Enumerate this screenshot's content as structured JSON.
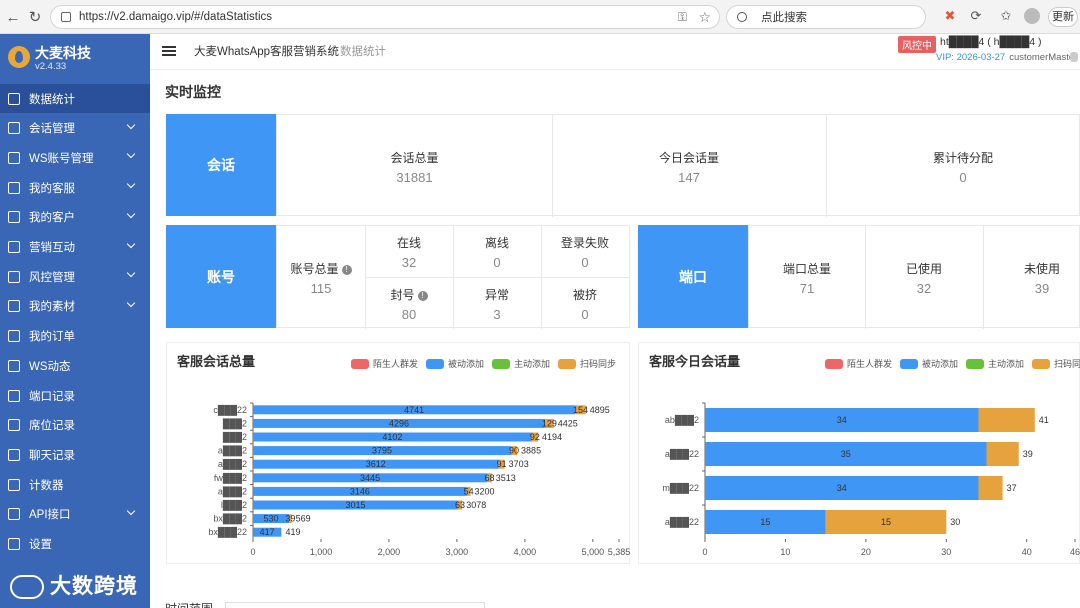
{
  "browser": {
    "url": "https://v2.damaigo.vip/#/dataStatistics",
    "search_placeholder": "点此搜索",
    "update_label": "更新"
  },
  "sidebar": {
    "brand": "大麦科技",
    "version": "v2.4.33",
    "items": [
      {
        "label": "数据统计",
        "icon": "bar-chart-icon",
        "expandable": false
      },
      {
        "label": "会话管理",
        "icon": "gear-icon",
        "expandable": true
      },
      {
        "label": "WS账号管理",
        "icon": "whatsapp-icon",
        "expandable": true
      },
      {
        "label": "我的客服",
        "icon": "headset-icon",
        "expandable": true
      },
      {
        "label": "我的客户",
        "icon": "user-icon",
        "expandable": true
      },
      {
        "label": "营销互动",
        "icon": "megaphone-icon",
        "expandable": true
      },
      {
        "label": "风控管理",
        "icon": "bell-icon",
        "expandable": true
      },
      {
        "label": "我的素材",
        "icon": "image-icon",
        "expandable": true
      },
      {
        "label": "我的订单",
        "icon": "order-icon",
        "expandable": false
      },
      {
        "label": "WS动态",
        "icon": "globe-icon",
        "expandable": false
      },
      {
        "label": "端口记录",
        "icon": "port-icon",
        "expandable": false
      },
      {
        "label": "席位记录",
        "icon": "seat-icon",
        "expandable": false
      },
      {
        "label": "聊天记录",
        "icon": "chat-icon",
        "expandable": false
      },
      {
        "label": "计数器",
        "icon": "calculator-icon",
        "expandable": false
      },
      {
        "label": "API接口",
        "icon": "api-icon",
        "expandable": true
      },
      {
        "label": "设置",
        "icon": "settings-icon",
        "expandable": false
      }
    ],
    "watermark": "大数跨境"
  },
  "header": {
    "breadcrumb_root": "大麦WhatsApp客服营销系统",
    "breadcrumb_current": "数据统计",
    "risk_badge": "风控中",
    "account": "ht████4 ( h████4 )",
    "vip": "VIP: 2026-03-27",
    "user": "customerMaster"
  },
  "main": {
    "section_title": "实时监控",
    "session": {
      "tile": "会话",
      "total_label": "会话总量",
      "total_value": "31881",
      "today_label": "今日会话量",
      "today_value": "147",
      "pending_label": "累计待分配",
      "pending_value": "0"
    },
    "account": {
      "tile": "账号",
      "total_label": "账号总量",
      "total_value": "115",
      "online_label": "在线",
      "online_value": "32",
      "offline_label": "离线",
      "offline_value": "0",
      "loginfail_label": "登录失败",
      "loginfail_value": "0",
      "banned_label": "封号",
      "banned_value": "80",
      "abnormal_label": "异常",
      "abnormal_value": "3",
      "kicked_label": "被挤",
      "kicked_value": "0"
    },
    "port": {
      "tile": "端口",
      "total_label": "端口总量",
      "total_value": "71",
      "used_label": "已使用",
      "used_value": "32",
      "unused_label": "未使用",
      "unused_value": "39"
    },
    "bottom_label": "时间范围"
  },
  "legend": [
    {
      "name": "陌生人群发",
      "color": "#ee6666"
    },
    {
      "name": "被动添加",
      "color": "#3f96f4"
    },
    {
      "name": "主动添加",
      "color": "#67c23a"
    },
    {
      "name": "扫码同步",
      "color": "#e6a23c"
    }
  ],
  "chart_data": [
    {
      "type": "bar",
      "orientation": "horizontal",
      "stacked": true,
      "title": "客服会话总量",
      "categories": [
        "c███22",
        "███2",
        "███2",
        "a███2",
        "a███2",
        "fw███2",
        "a███2",
        "l███2",
        "bx███2",
        "bx███22"
      ],
      "series": [
        {
          "name": "陌生人群发",
          "values": [
            0,
            0,
            0,
            0,
            0,
            0,
            0,
            0,
            0,
            0
          ]
        },
        {
          "name": "被动添加",
          "values": [
            4741,
            4296,
            4102,
            3795,
            3612,
            3445,
            3146,
            3015,
            530,
            417
          ]
        },
        {
          "name": "主动添加",
          "values": [
            0,
            0,
            0,
            0,
            0,
            0,
            0,
            0,
            0,
            0
          ]
        },
        {
          "name": "扫码同步",
          "values": [
            154,
            129,
            92,
            90,
            91,
            68,
            54,
            63,
            39,
            2
          ]
        }
      ],
      "series_labels": {
        "被动添加": [
          "4741",
          "4296",
          "4102",
          "3795",
          "3612",
          "3445",
          "3146",
          "3015",
          "530",
          "417"
        ],
        "扫码同步": [
          "154",
          "129",
          "92",
          "90",
          "91",
          "68",
          "54",
          "63",
          "39",
          ""
        ]
      },
      "totals": [
        4895,
        4425,
        4194,
        3885,
        3703,
        3513,
        3200,
        3078,
        569,
        419
      ],
      "xlim": [
        0,
        5385
      ],
      "xticks": [
        "0",
        "1,000",
        "2,000",
        "3,000",
        "4,000",
        "5,000",
        "5,385"
      ]
    },
    {
      "type": "bar",
      "orientation": "horizontal",
      "stacked": true,
      "title": "客服今日会话量",
      "categories": [
        "ab███2",
        "a███22",
        "m███22",
        "a███22"
      ],
      "series": [
        {
          "name": "陌生人群发",
          "values": [
            0,
            0,
            0,
            0
          ]
        },
        {
          "name": "被动添加",
          "values": [
            34,
            35,
            34,
            15
          ]
        },
        {
          "name": "主动添加",
          "values": [
            0,
            0,
            0,
            0
          ]
        },
        {
          "name": "扫码同步",
          "values": [
            7,
            4,
            3,
            15
          ]
        }
      ],
      "series_labels": {
        "被动添加": [
          "34",
          "35",
          "34",
          "15"
        ],
        "扫码同步": [
          "",
          "",
          "",
          "15"
        ]
      },
      "totals": [
        41,
        39,
        37,
        30
      ],
      "xlim": [
        0,
        46
      ],
      "xticks": [
        "0",
        "10",
        "20",
        "30",
        "40",
        "46"
      ]
    }
  ]
}
